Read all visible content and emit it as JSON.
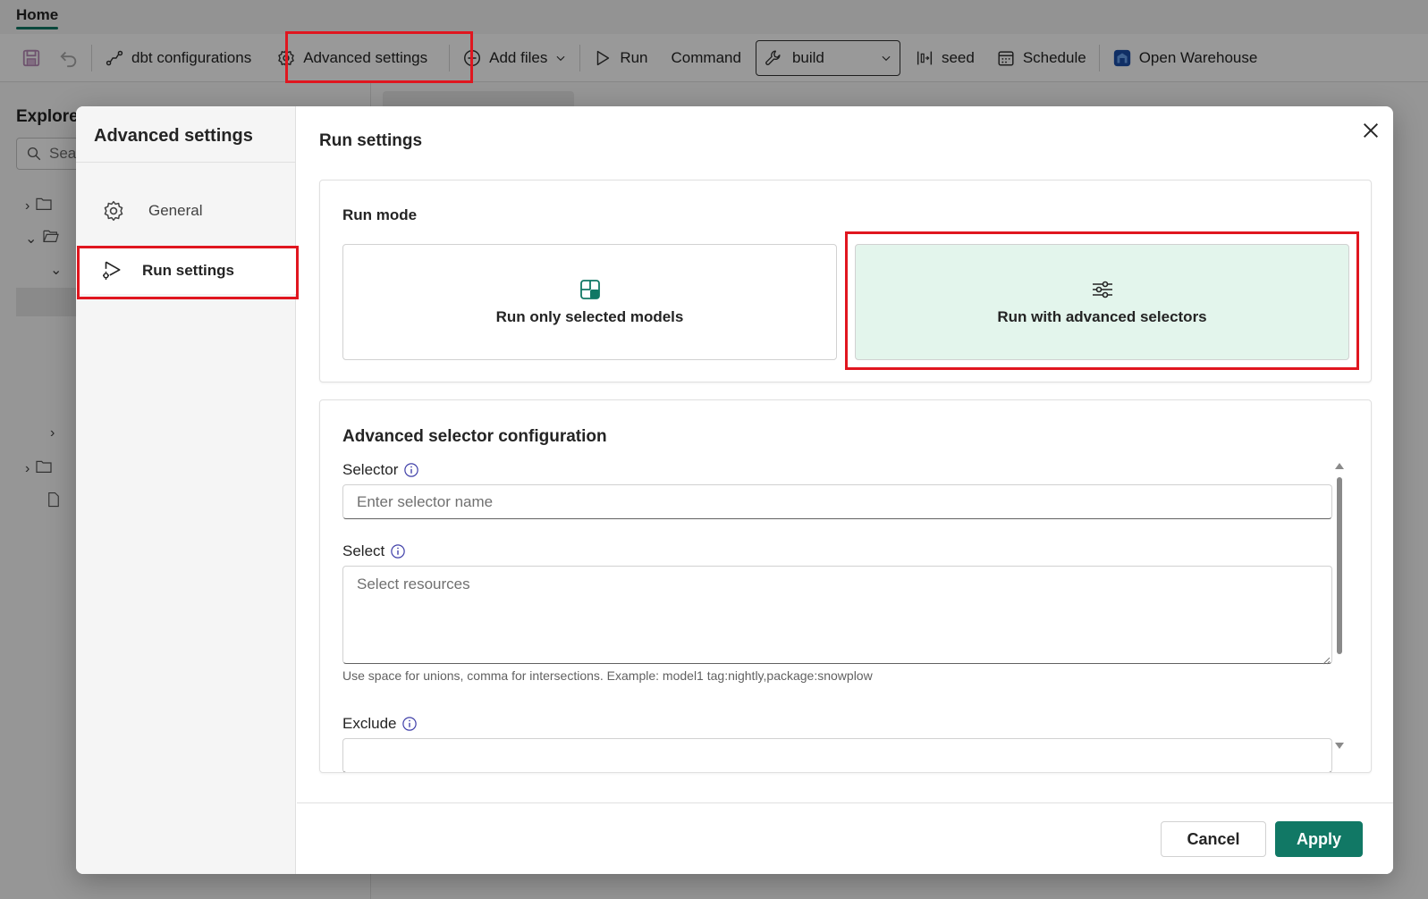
{
  "tabbar": {
    "home_tab": "Home"
  },
  "toolbar": {
    "dbt_configurations": "dbt configurations",
    "advanced_settings": "Advanced settings",
    "add_files": "Add files",
    "run": "Run",
    "command": "Command",
    "command_value": "build",
    "seed": "seed",
    "schedule": "Schedule",
    "open_warehouse": "Open Warehouse"
  },
  "explorer": {
    "title": "Explore",
    "search_placeholder": "Sea"
  },
  "dialog": {
    "sidebar_title": "Advanced settings",
    "nav": [
      {
        "label": "General",
        "icon": "gear-icon"
      },
      {
        "label": "Run settings",
        "icon": "run-settings-icon"
      }
    ],
    "title": "Run settings",
    "close_label": "Close",
    "run_mode": {
      "label": "Run mode",
      "options": [
        {
          "label": "Run only selected models",
          "icon": "selected-models-icon",
          "selected": false
        },
        {
          "label": "Run with advanced selectors",
          "icon": "sliders-icon",
          "selected": true
        }
      ]
    },
    "advanced": {
      "title": "Advanced selector configuration",
      "selector_label": "Selector",
      "selector_placeholder": "Enter selector name",
      "select_label": "Select",
      "select_placeholder": "Select resources",
      "select_hint": "Use space for unions, comma for intersections. Example: model1 tag:nightly,package:snowplow",
      "exclude_label": "Exclude"
    },
    "footer": {
      "cancel": "Cancel",
      "apply": "Apply"
    }
  },
  "colors": {
    "accent": "#117865",
    "highlight": "#e0161f",
    "selected_option_bg": "#e3f5ec"
  }
}
